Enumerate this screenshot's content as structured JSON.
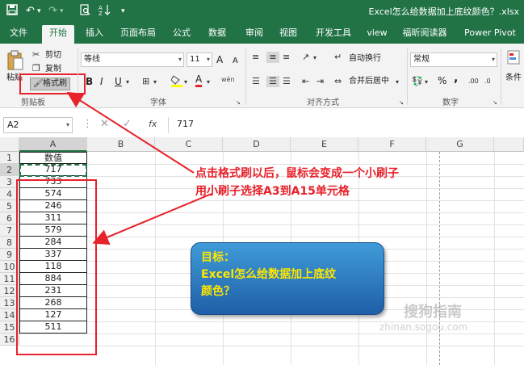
{
  "window": {
    "title": "Excel怎么给数据加上底纹颜色？.xlsx",
    "quick_access": {
      "undo": "↶",
      "redo": "↷",
      "dropdown": "▾"
    }
  },
  "tabs": [
    {
      "label": "文件"
    },
    {
      "label": "开始",
      "active": true
    },
    {
      "label": "插入"
    },
    {
      "label": "页面布局"
    },
    {
      "label": "公式"
    },
    {
      "label": "数据"
    },
    {
      "label": "审阅"
    },
    {
      "label": "视图"
    },
    {
      "label": "开发工具"
    },
    {
      "label": "view"
    },
    {
      "label": "福昕阅读器"
    },
    {
      "label": "Power Pivot"
    }
  ],
  "ribbon": {
    "clipboard": {
      "paste": "粘贴",
      "cut": "剪切",
      "copy": "复制",
      "format_painter": "格式刷",
      "group": "剪贴板"
    },
    "font": {
      "font_name": "等线",
      "font_size": "11",
      "bold": "B",
      "italic": "I",
      "underline": "U",
      "group": "字体",
      "grow": "A",
      "shrink": "A",
      "wen": "wén"
    },
    "alignment": {
      "wrap": "自动换行",
      "merge": "合并后居中",
      "group": "对齐方式"
    },
    "number": {
      "format": "常规",
      "percent": "%",
      "comma": ",",
      "group": "数字"
    },
    "styles": {
      "conditional": "条件"
    }
  },
  "formula_bar": {
    "name_box": "A2",
    "fx": "fx",
    "value": "717"
  },
  "sheet": {
    "columns": [
      "A",
      "B",
      "C",
      "D",
      "E",
      "F",
      "G"
    ],
    "rows": [
      "1",
      "2",
      "3",
      "4",
      "5",
      "6",
      "7",
      "8",
      "9",
      "10",
      "11",
      "12",
      "13",
      "14",
      "15",
      "16"
    ],
    "header_cell": "数值",
    "values": [
      "717",
      "733",
      "574",
      "246",
      "311",
      "579",
      "284",
      "337",
      "118",
      "884",
      "231",
      "268",
      "127",
      "511"
    ]
  },
  "annotation": {
    "line1": "点击格式刷以后，鼠标会变成一个小刷子",
    "line2": "用小刷子选择A3到A15单元格"
  },
  "goal_box": {
    "line1": "目标：",
    "line2": "Excel怎么给数据加上底纹",
    "line3": "颜色？"
  },
  "watermark": {
    "text": "搜狗指南",
    "url": "zhinan.sogou.com"
  },
  "colors": {
    "excel_green": "#217346",
    "annotation_red": "#e8212b",
    "goal_yellow": "#ffe600",
    "goal_blue": "#2b7cc4"
  }
}
